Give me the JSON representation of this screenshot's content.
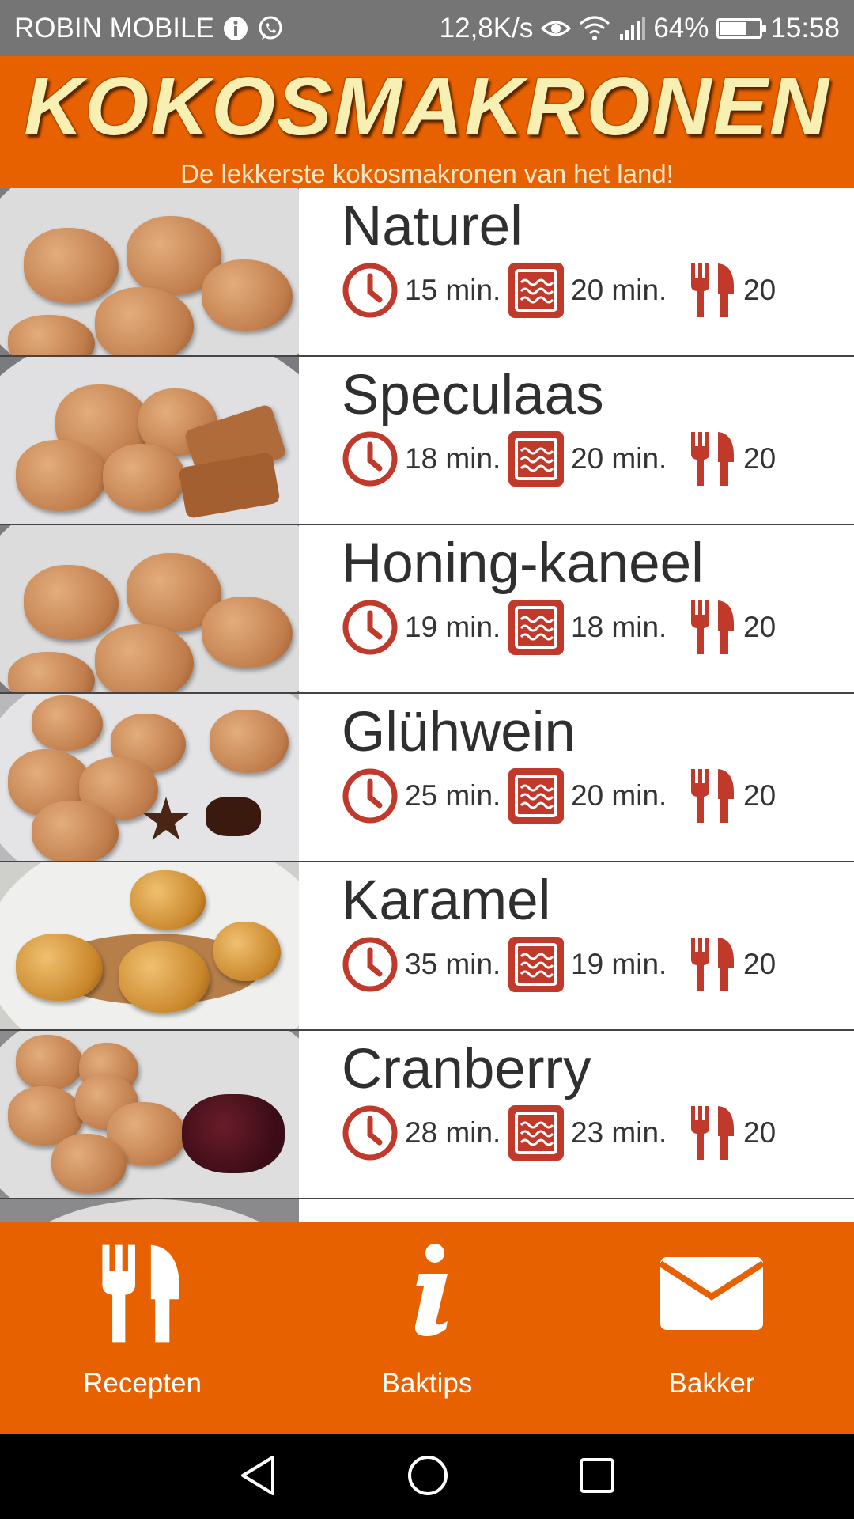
{
  "status_bar": {
    "carrier": "ROBIN MOBILE",
    "network_speed": "12,8K/s",
    "battery_percent": "64%",
    "time": "15:58"
  },
  "header": {
    "title": "KOKOSMAKRONEN",
    "subtitle": "De lekkerste kokosmakronen van het land!"
  },
  "recipes": [
    {
      "name": "Naturel",
      "prep_time": "15 min.",
      "bake_time": "20 min.",
      "servings": "20"
    },
    {
      "name": "Speculaas",
      "prep_time": "18 min.",
      "bake_time": "20 min.",
      "servings": "20"
    },
    {
      "name": "Honing-kaneel",
      "prep_time": "19 min.",
      "bake_time": "18 min.",
      "servings": "20"
    },
    {
      "name": "Glühwein",
      "prep_time": "25 min.",
      "bake_time": "20 min.",
      "servings": "20"
    },
    {
      "name": "Karamel",
      "prep_time": "35 min.",
      "bake_time": "19 min.",
      "servings": "20"
    },
    {
      "name": "Cranberry",
      "prep_time": "28 min.",
      "bake_time": "23 min.",
      "servings": "20"
    }
  ],
  "bottom_nav": {
    "items": [
      {
        "label": "Recepten",
        "icon": "cutlery-icon"
      },
      {
        "label": "Baktips",
        "icon": "info-icon"
      },
      {
        "label": "Bakker",
        "icon": "envelope-icon"
      }
    ]
  },
  "colors": {
    "brand_orange": "#e86100",
    "icon_red": "#c0392b",
    "title_cream": "#f8f0b2"
  }
}
